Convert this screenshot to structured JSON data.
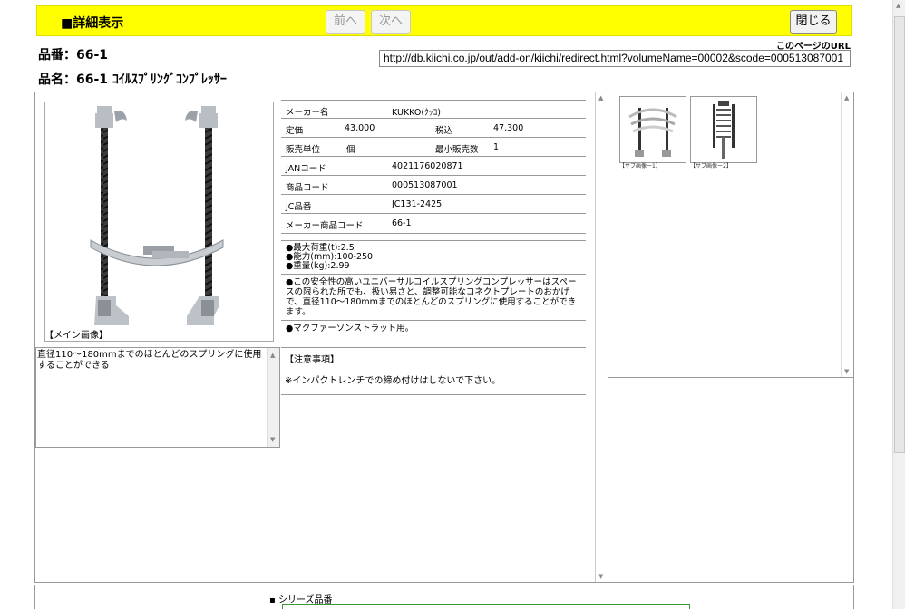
{
  "header": {
    "title": "■詳細表示",
    "prev_label": "前へ",
    "next_label": "次へ",
    "close_label": "閉じる"
  },
  "product": {
    "hinban": "品番：66-1",
    "hinmei": "品名：66-1 ｺｲﾙｽﾌﾟﾘﾝｸﾞｺﾝﾌﾟﾚｯｻｰ"
  },
  "page_url": {
    "label": "このページのURL",
    "value": "http://db.kiichi.co.jp/out/add-on/kiichi/redirect.html?volumeName=00002&scode=000513087001"
  },
  "main_image": {
    "caption": "【メイン画像】"
  },
  "description": "直径110～180mmまでのほとんどのスプリングに使用することができる",
  "spec": {
    "maker_label": "メーカー名",
    "maker_value": "KUKKO(ｸｯｺ)",
    "price_label": "定価",
    "price_value": "43,000",
    "taxin_label": "税込",
    "taxin_value": "47,300",
    "unit_label": "販売単位",
    "unit_value": "個",
    "minqty_label": "最小販売数",
    "minqty_value": "1",
    "jan_label": "JANコード",
    "jan_value": "4021176020871",
    "code_label": "商品コード",
    "code_value": "000513087001",
    "jc_label": "JC品番",
    "jc_value": "JC131-2425",
    "makercode_label": "メーカー商品コード",
    "makercode_value": "66-1"
  },
  "bullets_specs": [
    "●最大荷重(t):2.5",
    "●能力(mm):100-250",
    "●重量(kg):2.99"
  ],
  "bullet_feature": "●この安全性の高いユニバーサルコイルスプリングコンプレッサーはスペースの限られた所でも、扱い易さと、調整可能なコネクトプレートのおかげで、直径110～180mmまでのほとんどのスプリングに使用することができます。",
  "bullet_note": "●マクファーソンストラット用。",
  "notes": {
    "heading": "【注意事項】",
    "text": "※インパクトレンチでの締め付けはしないで下さい。"
  },
  "thumbnails": [
    {
      "caption": "【サブ画像ー1】"
    },
    {
      "caption": "【サブ画像ー2】"
    }
  ],
  "series": {
    "label": "シリーズ品番"
  }
}
